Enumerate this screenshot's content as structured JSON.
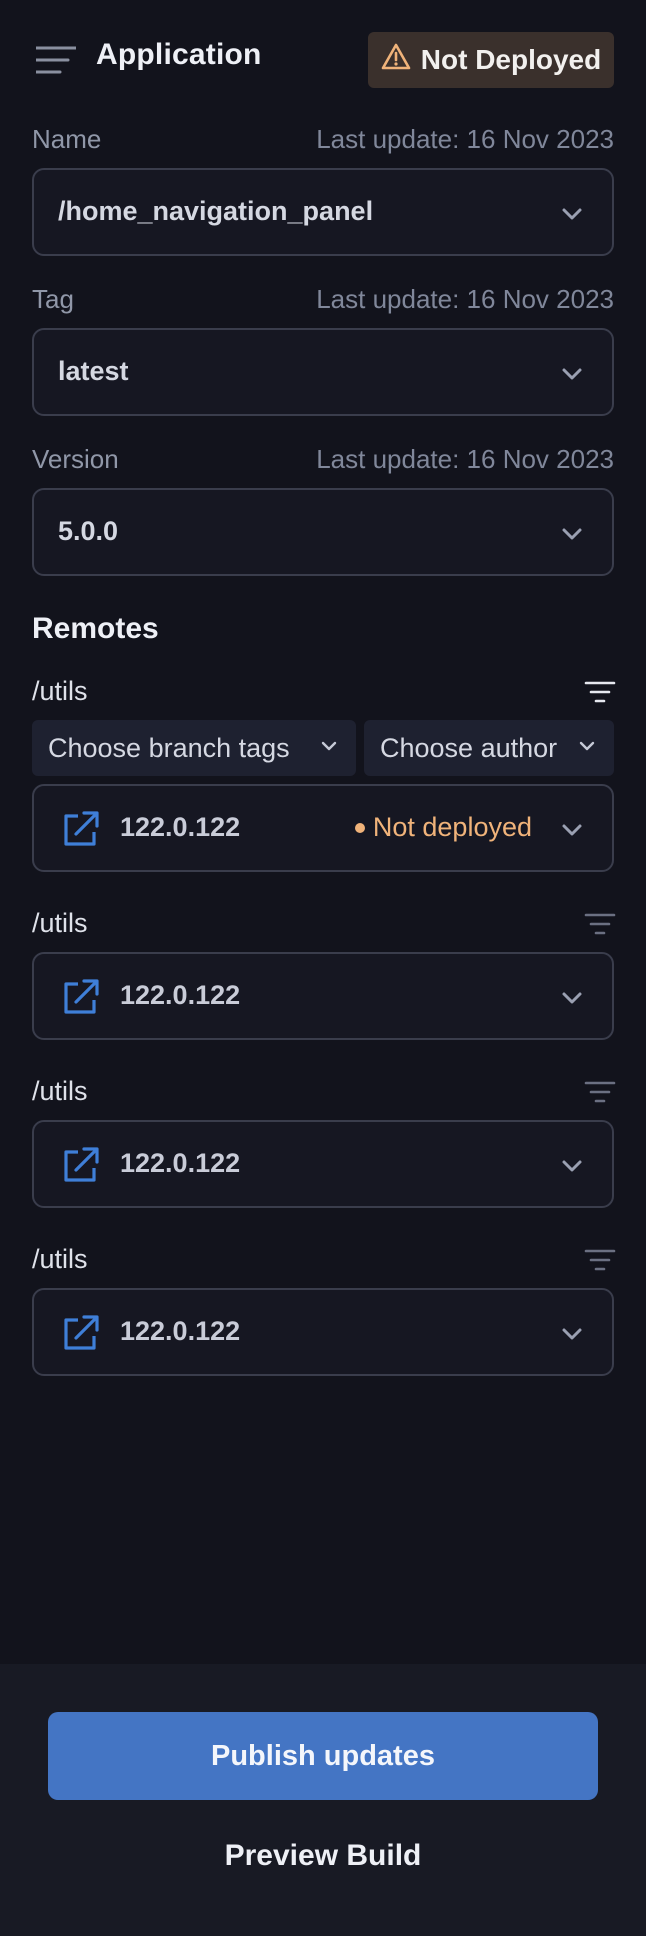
{
  "header": {
    "title": "Application",
    "menu_icon": "hamburger-icon",
    "status_badge": {
      "label": "Not Deployed",
      "icon": "warning-icon",
      "color": "#f0b37a"
    }
  },
  "fields": [
    {
      "label": "Name",
      "last_update": "Last update: 16 Nov 2023",
      "value": "/home_navigation_panel"
    },
    {
      "label": "Tag",
      "last_update": "Last update: 16 Nov 2023",
      "value": "latest"
    },
    {
      "label": "Version",
      "last_update": "Last update: 16 Nov 2023",
      "value": "5.0.0"
    }
  ],
  "remotes": {
    "title": "Remotes",
    "filters": {
      "branch_tags": "Choose branch tags",
      "author": "Choose author"
    },
    "items": [
      {
        "path": "/utils",
        "version": "122.0.122",
        "status": "Not deployed"
      },
      {
        "path": "/utils",
        "version": "122.0.122"
      },
      {
        "path": "/utils",
        "version": "122.0.122"
      },
      {
        "path": "/utils",
        "version": "122.0.122"
      }
    ]
  },
  "footer": {
    "publish_label": "Publish updates",
    "preview_label": "Preview Build"
  },
  "colors": {
    "background": "#12131c",
    "accent": "#4475c4",
    "warning": "#f0b37a",
    "icon_blue": "#3f7fd8"
  }
}
